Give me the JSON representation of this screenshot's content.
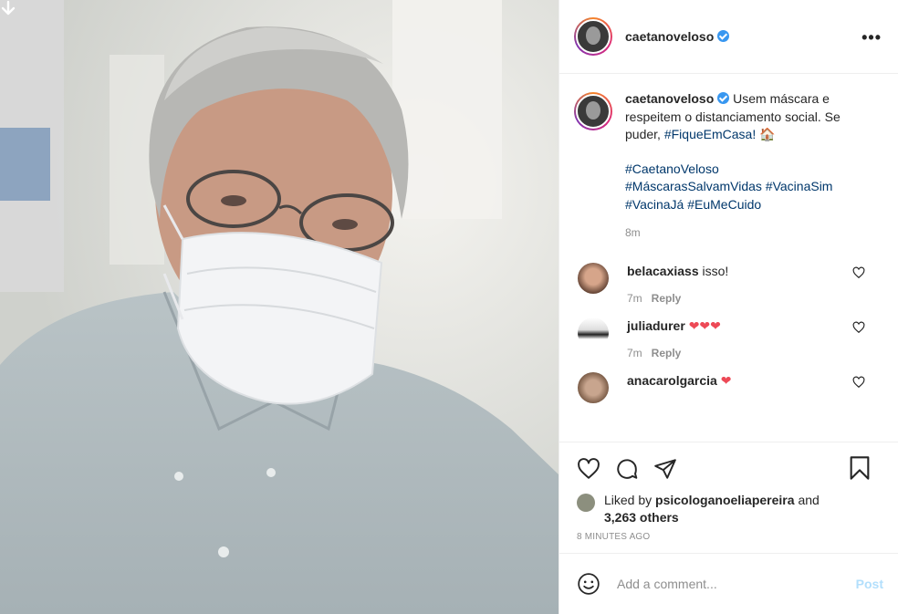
{
  "post": {
    "username": "caetanoveloso",
    "caption": "Usem máscara e respeitem o distanciamento social. Se puder,",
    "caption_tag": "#FiqueEmCasa!",
    "caption_emoji": "🏠",
    "hashtags_line1": "#CaetanoVeloso",
    "hashtags_line2": "#MáscarasSalvamVidas #VacinaSim",
    "hashtags_line3": "#VacinaJá #EuMeCuido",
    "time": "8m"
  },
  "comments": [
    {
      "user": "belacaxiass",
      "text": "isso!",
      "time": "7m",
      "reply": "Reply"
    },
    {
      "user": "juliadurer",
      "text": "❤❤❤",
      "time": "7m",
      "reply": "Reply"
    },
    {
      "user": "anacarolgarcia",
      "text": "❤",
      "time": "",
      "reply": ""
    }
  ],
  "likes": {
    "prefix": "Liked by",
    "user": "psicologanoeliapereira",
    "suffix": "and",
    "others": "3,263 others"
  },
  "posted_ago": "8 MINUTES AGO",
  "composer": {
    "placeholder": "Add a comment...",
    "post_label": "Post"
  },
  "icons": {
    "download": "download-arrow-icon",
    "more": "more-options-icon",
    "like": "heart-icon",
    "comment": "comment-bubble-icon",
    "share": "paper-plane-icon",
    "save": "bookmark-icon",
    "emoji": "emoji-smile-icon"
  },
  "colors": {
    "verified": "#3897f0",
    "hashtag": "#00376b",
    "heart_red": "#ed4956",
    "post_disabled": "#b2dffc"
  }
}
